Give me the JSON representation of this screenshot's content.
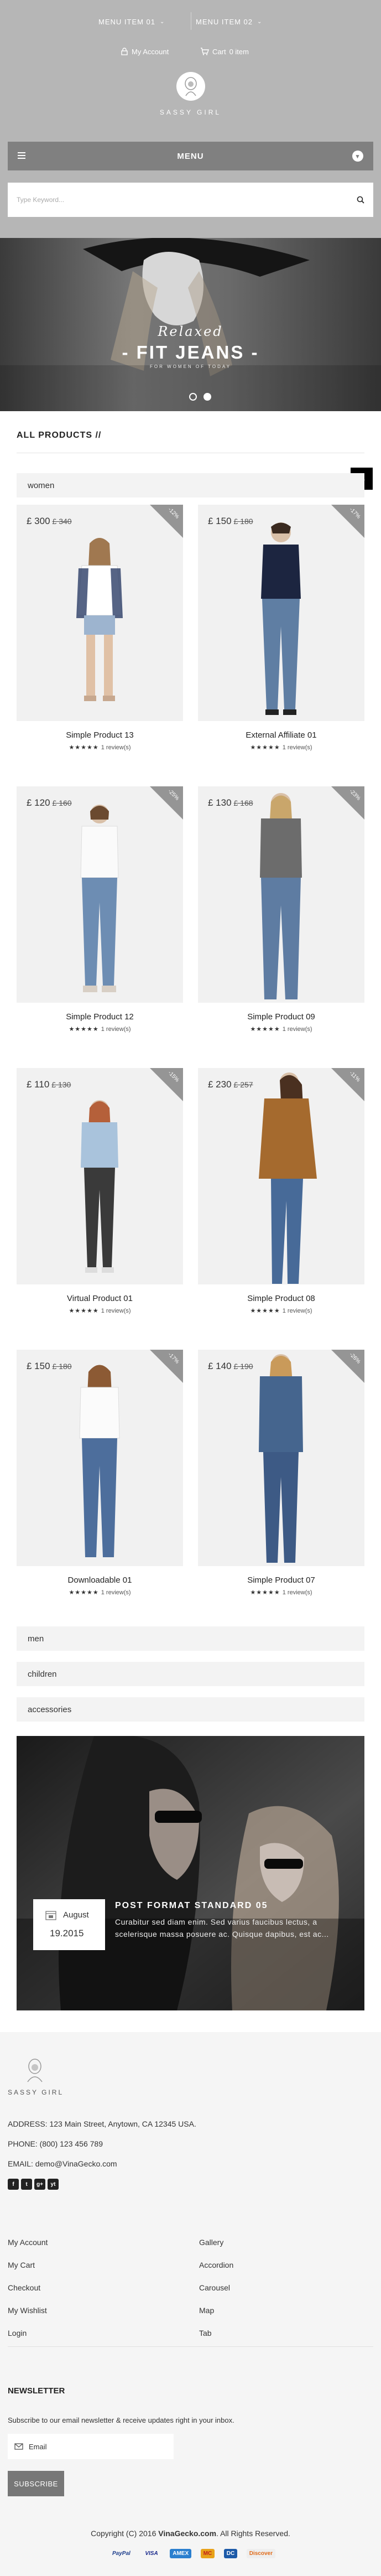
{
  "header": {
    "menu_items": [
      {
        "label": "MENU ITEM 01"
      },
      {
        "label": "MENU ITEM 02"
      }
    ],
    "my_account_label": "My Account",
    "cart_label": "Cart",
    "cart_count": "0 item",
    "logo_text": "SASSY GIRL",
    "mobile_menu_label": "MENU",
    "search_placeholder": "Type Keyword..."
  },
  "banner": {
    "script_title": "Relaxed",
    "main_title": "- FIT JEANS -",
    "subtitle": "FOR WOMEN OF TODAY",
    "slides": 2
  },
  "products_section": {
    "title": "ALL PRODUCTS //",
    "categories": [
      {
        "label": "women"
      },
      {
        "label": "men"
      },
      {
        "label": "children"
      },
      {
        "label": "accessories"
      }
    ],
    "products": [
      {
        "name": "Simple Product 13",
        "price": "£ 300",
        "old_price": "£ 340",
        "badge": "-12%",
        "rating": "★★★★★",
        "reviews": "1 review(s)"
      },
      {
        "name": "External Affiliate 01",
        "price": "£ 150",
        "old_price": "£ 180",
        "badge": "-17%",
        "rating": "★★★★★",
        "reviews": "1 review(s)"
      },
      {
        "name": "Simple Product 12",
        "price": "£ 120",
        "old_price": "£ 160",
        "badge": "-25%",
        "rating": "★★★★★",
        "reviews": "1 review(s)"
      },
      {
        "name": "Simple Product 09",
        "price": "£ 130",
        "old_price": "£ 168",
        "badge": "-23%",
        "rating": "★★★★★",
        "reviews": "1 review(s)"
      },
      {
        "name": "Virtual Product 01",
        "price": "£ 110",
        "old_price": "£ 130",
        "badge": "-15%",
        "rating": "★★★★★",
        "reviews": "1 review(s)"
      },
      {
        "name": "Simple Product 08",
        "price": "£ 230",
        "old_price": "£ 257",
        "badge": "-11%",
        "rating": "★★★★★",
        "reviews": "1 review(s)"
      },
      {
        "name": "Downloadable 01",
        "price": "£ 150",
        "old_price": "£ 180",
        "badge": "-17%",
        "rating": "★★★★★",
        "reviews": "1 review(s)"
      },
      {
        "name": "Simple Product 07",
        "price": "£ 140",
        "old_price": "£ 190",
        "badge": "-26%",
        "rating": "★★★★★",
        "reviews": "1 review(s)"
      }
    ]
  },
  "blog": {
    "title": "POST FORMAT STANDARD 05",
    "excerpt": "Curabitur sed diam enim. Sed varius faucibus lectus, a scelerisque massa posuere ac. Quisque dapibus, est ac...",
    "month": "August",
    "day_year": "19.2015"
  },
  "footer": {
    "logo_text": "SASSY GIRL",
    "address": "ADDRESS: 123 Main Street, Anytown, CA 12345 USA.",
    "phone": "PHONE: (800) 123 456 789",
    "email": "EMAIL: demo@VinaGecko.com",
    "social": [
      "f",
      "t",
      "g+",
      "yt"
    ],
    "links_left": [
      "My Account",
      "My Cart",
      "Checkout",
      "My Wishlist",
      "Login"
    ],
    "links_right": [
      "Gallery",
      "Accordion",
      "Carousel",
      "Map",
      "Tab"
    ],
    "newsletter_title": "NEWSLETTER",
    "newsletter_desc": "Subscribe to our email newsletter & receive updates right in your inbox.",
    "email_placeholder": "Email",
    "subscribe_label": "SUBSCRIBE",
    "copyright_prefix": "Copyright (C) 2016 ",
    "copyright_brand": "VinaGecko.com",
    "copyright_suffix": ". All Rights Reserved.",
    "payments": [
      "PayPal",
      "VISA",
      "AMEX",
      "MC",
      "DC",
      "Discover"
    ]
  },
  "colors": {
    "header_bg": "#b6b6b6",
    "menu_bar": "#808080",
    "sale_badge": "#959595",
    "footer_bg": "#f5f5f5"
  }
}
